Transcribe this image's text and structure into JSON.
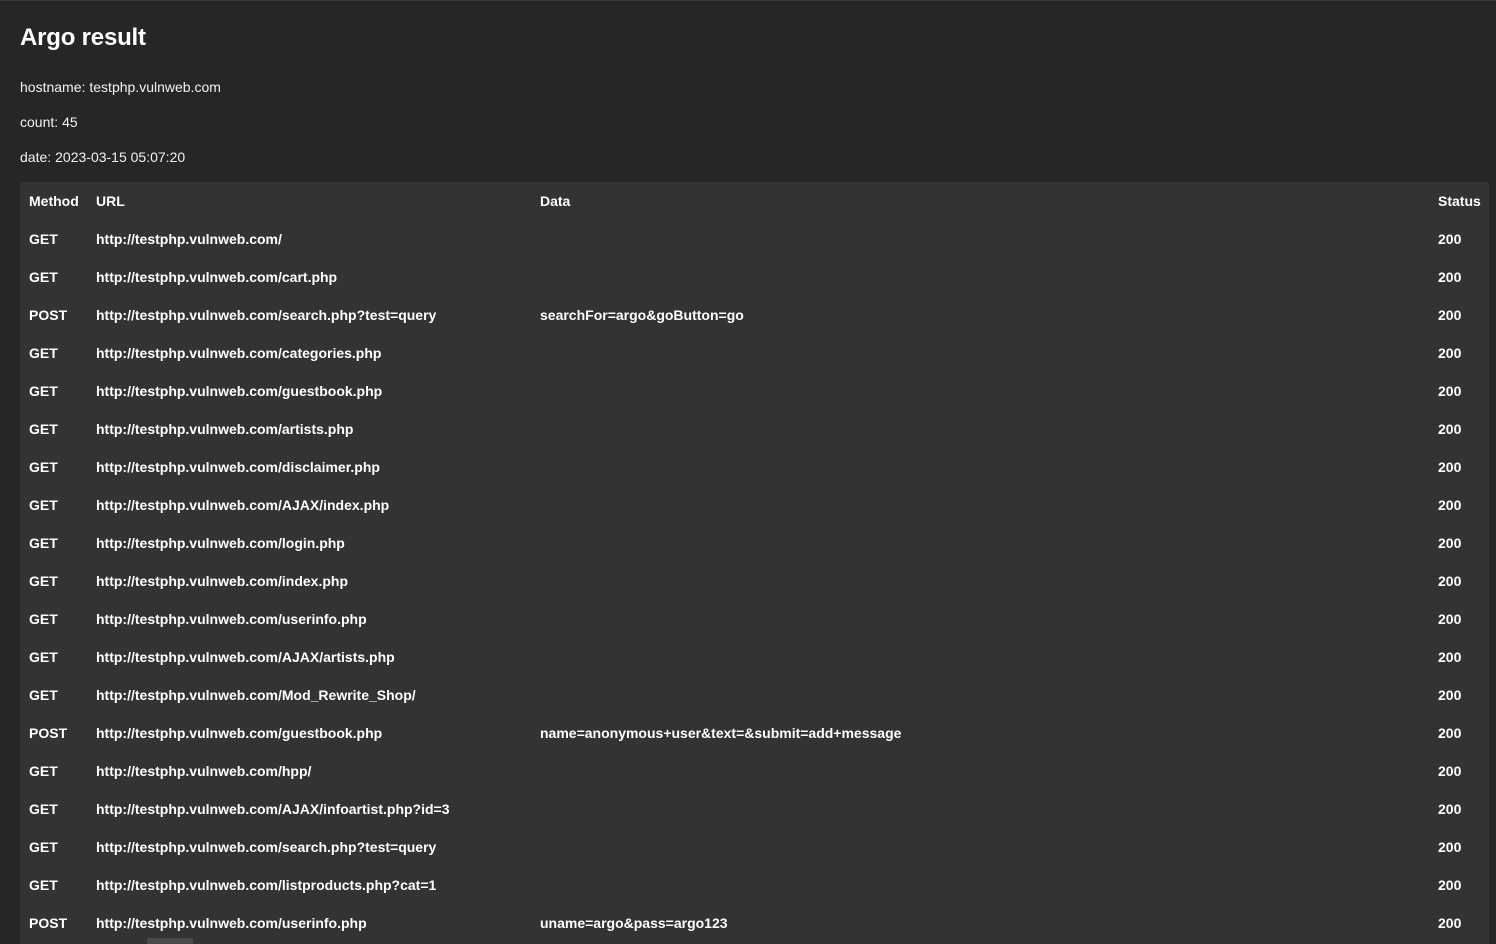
{
  "title": "Argo result",
  "meta": {
    "hostname_label": "hostname:",
    "hostname": "testphp.vulnweb.com",
    "count_label": "count:",
    "count": "45",
    "date_label": "date:",
    "date": "2023-03-15 05:07:20"
  },
  "table": {
    "headers": {
      "method": "Method",
      "url": "URL",
      "data": "Data",
      "status": "Status"
    },
    "rows": [
      {
        "method": "GET",
        "url": "http://testphp.vulnweb.com/",
        "data": "",
        "status": "200"
      },
      {
        "method": "GET",
        "url": "http://testphp.vulnweb.com/cart.php",
        "data": "",
        "status": "200"
      },
      {
        "method": "POST",
        "url": "http://testphp.vulnweb.com/search.php?test=query",
        "data": "searchFor=argo&goButton=go",
        "status": "200"
      },
      {
        "method": "GET",
        "url": "http://testphp.vulnweb.com/categories.php",
        "data": "",
        "status": "200"
      },
      {
        "method": "GET",
        "url": "http://testphp.vulnweb.com/guestbook.php",
        "data": "",
        "status": "200"
      },
      {
        "method": "GET",
        "url": "http://testphp.vulnweb.com/artists.php",
        "data": "",
        "status": "200"
      },
      {
        "method": "GET",
        "url": "http://testphp.vulnweb.com/disclaimer.php",
        "data": "",
        "status": "200"
      },
      {
        "method": "GET",
        "url": "http://testphp.vulnweb.com/AJAX/index.php",
        "data": "",
        "status": "200"
      },
      {
        "method": "GET",
        "url": "http://testphp.vulnweb.com/login.php",
        "data": "",
        "status": "200"
      },
      {
        "method": "GET",
        "url": "http://testphp.vulnweb.com/index.php",
        "data": "",
        "status": "200"
      },
      {
        "method": "GET",
        "url": "http://testphp.vulnweb.com/userinfo.php",
        "data": "",
        "status": "200"
      },
      {
        "method": "GET",
        "url": "http://testphp.vulnweb.com/AJAX/artists.php",
        "data": "",
        "status": "200"
      },
      {
        "method": "GET",
        "url": "http://testphp.vulnweb.com/Mod_Rewrite_Shop/",
        "data": "",
        "status": "200"
      },
      {
        "method": "POST",
        "url": "http://testphp.vulnweb.com/guestbook.php",
        "data": "name=anonymous+user&text=&submit=add+message",
        "status": "200"
      },
      {
        "method": "GET",
        "url": "http://testphp.vulnweb.com/hpp/",
        "data": "",
        "status": "200"
      },
      {
        "method": "GET",
        "url": "http://testphp.vulnweb.com/AJAX/infoartist.php?id=3",
        "data": "",
        "status": "200"
      },
      {
        "method": "GET",
        "url": "http://testphp.vulnweb.com/search.php?test=query",
        "data": "",
        "status": "200"
      },
      {
        "method": "GET",
        "url": "http://testphp.vulnweb.com/listproducts.php?cat=1",
        "data": "",
        "status": "200"
      },
      {
        "method": "POST",
        "url": "http://testphp.vulnweb.com/userinfo.php",
        "data": "uname=argo&pass=argo123",
        "status": "200"
      }
    ]
  },
  "colors": {
    "background": "#262626",
    "table_background": "#333333",
    "text": "#ffffff"
  }
}
